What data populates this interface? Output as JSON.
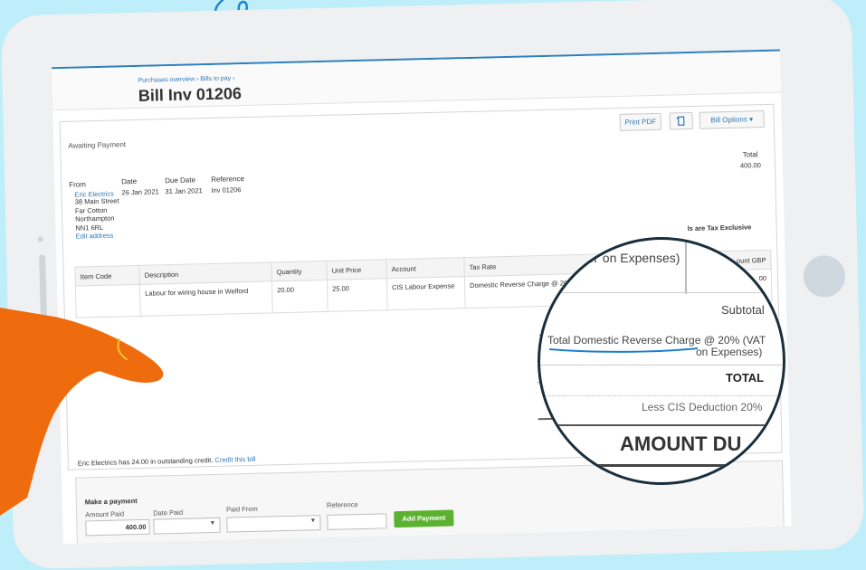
{
  "bill": {
    "breadcrumb": "Purchases overview › Bills to pay ›",
    "title": "Bill Inv 01206",
    "status": "Awaiting Payment",
    "buttons": {
      "print": "Print PDF",
      "options": "Bill Options ▾"
    },
    "headers": {
      "from": "From",
      "date": "Date",
      "due_date": "Due Date",
      "reference": "Reference",
      "total": "Total"
    },
    "values": {
      "from_name": "Eric Electrics",
      "address": [
        "38 Main Street",
        "Far Cotton",
        "Northampton",
        "NN1 6RL"
      ],
      "edit_address": "Edit address",
      "date": "26 Jan 2021",
      "due_date": "31 Jan 2021",
      "reference": "Inv 01206",
      "total": "400.00"
    },
    "amounts_note": "ls are Tax Exclusive",
    "table": {
      "columns": [
        "Item Code",
        "Description",
        "Quantity",
        "Unit Price",
        "Account",
        "Tax Rate"
      ],
      "amount_col": "ount GBP",
      "row": {
        "item_code": "",
        "description": "Labour for wiring house in Welford",
        "quantity": "20.00",
        "unit_price": "25.00",
        "account": "CIS Labour Expense",
        "tax_rate": "Domestic Reverse Charge @ 20% (VA",
        "amount": "00"
      }
    },
    "partial_label": "To",
    "credit": {
      "text": "Eric Electrics has 24.00 in outstanding credit.",
      "link": "Credit this bill"
    }
  },
  "payment": {
    "heading": "Make a payment",
    "labels": {
      "amount": "Amount Paid",
      "date": "Date Paid",
      "from": "Paid From",
      "reference": "Reference"
    },
    "amount_value": "400.00",
    "button": "Add Payment"
  },
  "magnifier": {
    "col_header": "VAT on Expenses)",
    "subtotal": "Subtotal",
    "vat_line1": "Total Domestic Reverse Charge @ 20% (VAT",
    "vat_line2": "on Expenses)",
    "total": "TOTAL",
    "cis": "Less CIS Deduction 20%",
    "amount_due": "AMOUNT DU"
  },
  "colors": {
    "background": "#bdeef9",
    "hand": "#ee6b0e",
    "accent": "#2f78b8",
    "add_button": "#5cb230"
  }
}
